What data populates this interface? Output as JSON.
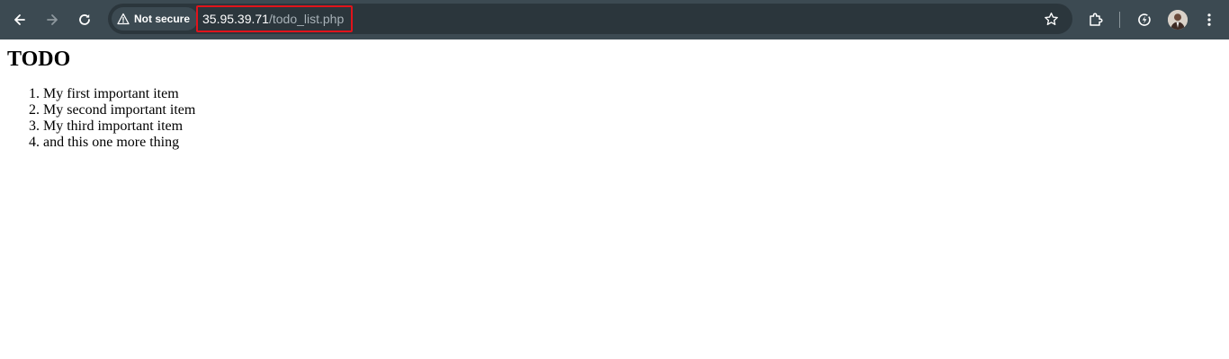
{
  "browser": {
    "security_label": "Not secure",
    "url_host": "35.95.39.71",
    "url_path": "/todo_list.php",
    "icons": {
      "back": "back-arrow-icon",
      "forward": "forward-arrow-icon",
      "reload": "reload-icon",
      "security": "warning-triangle-icon",
      "bookmark": "star-icon",
      "extensions": "puzzle-icon",
      "performance": "performance-icon",
      "profile": "avatar",
      "menu": "kebab-menu-icon"
    },
    "colors": {
      "toolbar": "#3c4a52",
      "omnibox": "#2b363c",
      "highlight": "#e0131b"
    }
  },
  "page": {
    "heading": "TODO",
    "items": [
      "My first important item",
      "My second important item",
      "My third important item",
      "and this one more thing"
    ]
  }
}
